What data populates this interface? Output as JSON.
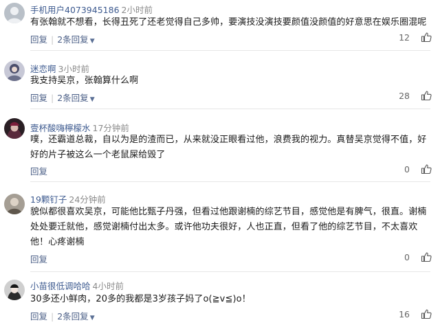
{
  "comments": [
    {
      "user": "手机用户4073945186",
      "time": "2小时前",
      "text": "有张翰就不想看，长得丑死了还老觉得自己多帅，要演技没演技要颜值没颜值的好意思在娱乐圈混呢",
      "reply_label": "回复",
      "replies_label": "2条回复",
      "likes": "12",
      "avatar_color": "#9aa3ad"
    },
    {
      "user": "迷恋啊",
      "time": "3小时前",
      "text": "我支持吴京，张翰算什么啊",
      "reply_label": "回复",
      "replies_label": "2条回复",
      "likes": "28",
      "avatar_color": "#6b6f8a"
    },
    {
      "user": "壹杯酸嗨檸檬水",
      "time": "17分钟前",
      "text": "噗，还霸道总裁，自以为是的渣而已，从来就没正眼看过他，浪费我的视力。真替吴京觉得不值，好好的片子被这么一个老鼠屎给毁了",
      "reply_label": "回复",
      "replies_label": "",
      "likes": "0",
      "avatar_color": "#5a2a3c"
    },
    {
      "user": "19颗钉子",
      "time": "24分钟前",
      "text": "貌似都很喜欢吴京，可能他比甄子丹强，但看过他跟谢楠的综艺节目，感觉他是有脾气，很直。谢楠处处要迁就他，感觉谢楠付出太多。或许他功夫很好，人也正直，但看了他的综艺节目，不太喜欢他！心疼谢楠",
      "reply_label": "回复",
      "replies_label": "",
      "likes": "0",
      "avatar_color": "#7d7468"
    },
    {
      "user": "小苗很低调哈哈",
      "time": "4小时前",
      "text": "30多还小鲜肉，20多的我都是3岁孩子妈了o(≧v≦)o！",
      "reply_label": "回复",
      "replies_label": "2条回复",
      "likes": "16",
      "avatar_color": "#3a3a3a"
    }
  ]
}
